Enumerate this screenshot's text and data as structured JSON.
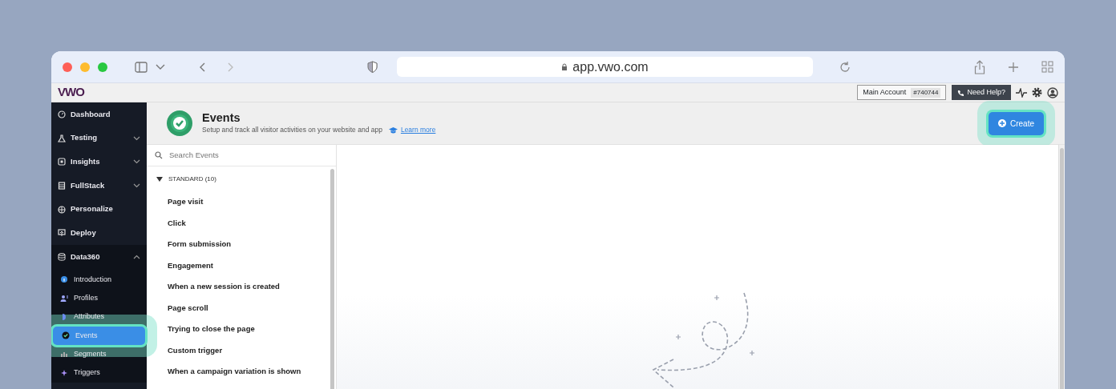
{
  "browser": {
    "url": "app.vwo.com"
  },
  "app_header": {
    "logo": "VWO",
    "account_label": "Main Account",
    "account_id": "#740744",
    "help": "Need Help?"
  },
  "sidebar": {
    "items": [
      {
        "label": "Dashboard",
        "selected": false
      },
      {
        "label": "Testing",
        "selected": false,
        "expanded": false
      },
      {
        "label": "Insights",
        "selected": false,
        "expanded": false
      },
      {
        "label": "FullStack",
        "selected": false,
        "expanded": false
      },
      {
        "label": "Personalize",
        "selected": false
      },
      {
        "label": "Deploy",
        "selected": false
      },
      {
        "label": "Data360",
        "selected": false,
        "expanded": true,
        "children": [
          {
            "label": "Introduction",
            "selected": false
          },
          {
            "label": "Profiles",
            "selected": false
          },
          {
            "label": "Attributes",
            "selected": false
          },
          {
            "label": "Events",
            "selected": true
          },
          {
            "label": "Segments",
            "selected": false
          },
          {
            "label": "Triggers",
            "selected": false
          }
        ]
      }
    ]
  },
  "page": {
    "title": "Events",
    "subtitle": "Setup and track all visitor activities on your website and app",
    "learn_more": "Learn more",
    "create_button": "Create"
  },
  "events_panel": {
    "search": {
      "placeholder": "Search Events"
    },
    "groups": [
      {
        "label": "STANDARD (10)",
        "expanded": true,
        "items": [
          "Page visit",
          "Click",
          "Form submission",
          "Engagement",
          "When a new session is created",
          "Page scroll",
          "Trying to close the page",
          "Custom trigger",
          "When a campaign variation is shown"
        ]
      }
    ]
  }
}
